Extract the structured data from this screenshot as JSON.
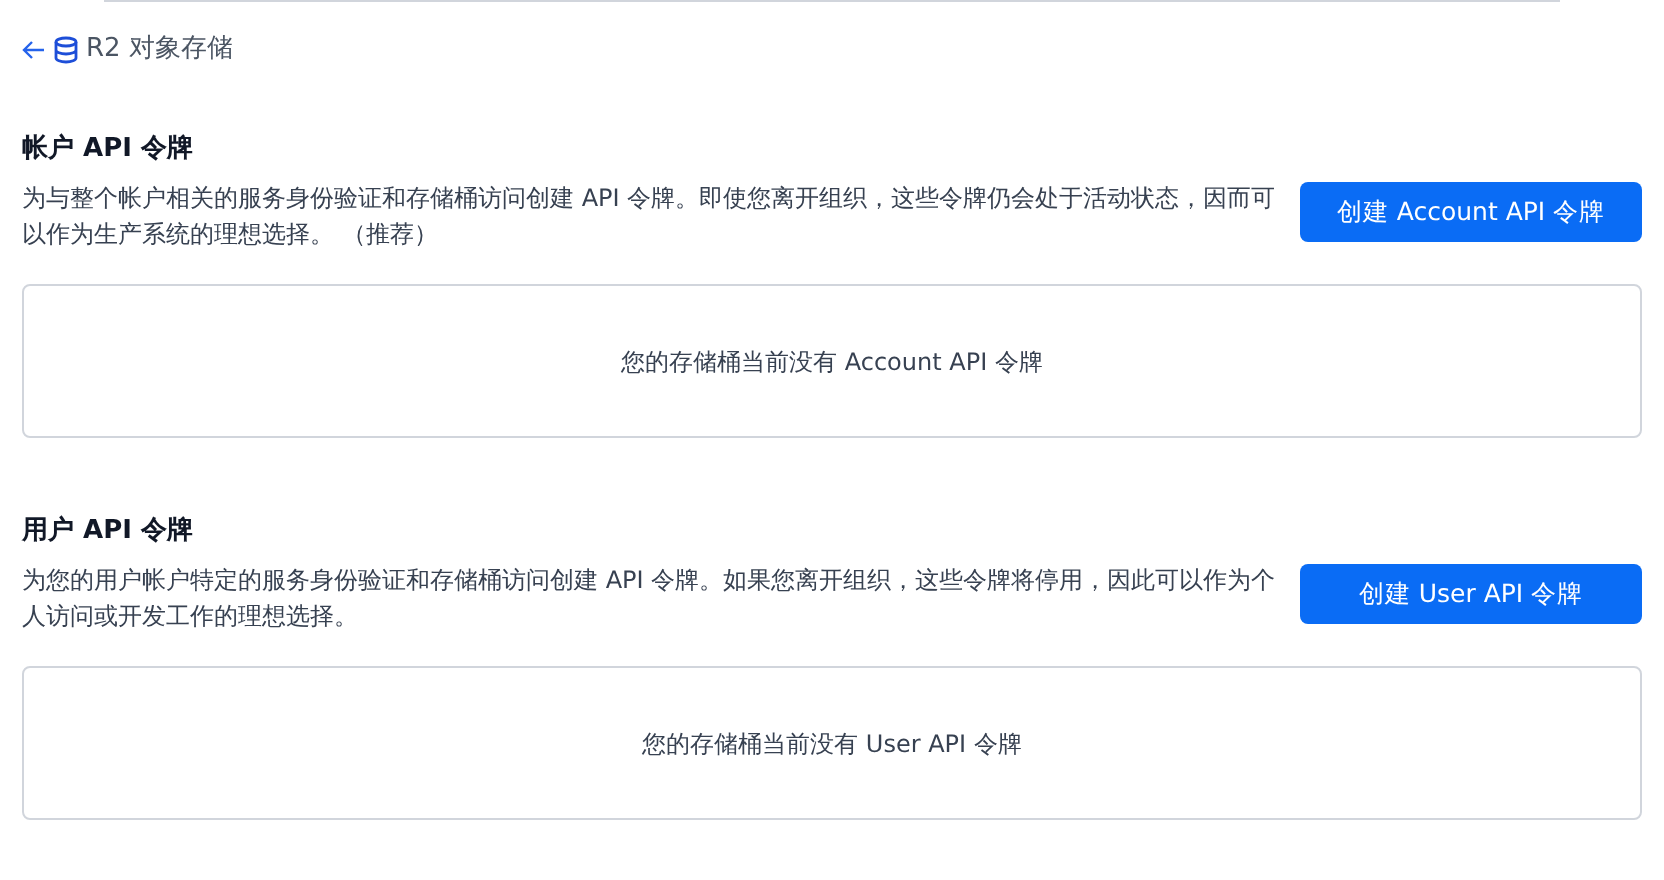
{
  "breadcrumb": {
    "label": "R2 对象存储"
  },
  "sections": [
    {
      "title": "帐户 API 令牌",
      "description": "为与整个帐户相关的服务身份验证和存储桶访问创建 API 令牌。即使您离开组织，这些令牌仍会处于活动状态，因而可以作为生产系统的理想选择。 （推荐）",
      "button": "创建 Account API 令牌",
      "empty_message": "您的存储桶当前没有 Account API 令牌"
    },
    {
      "title": "用户 API 令牌",
      "description": "为您的用户帐户特定的服务身份验证和存储桶访问创建 API 令牌。如果您离开组织，这些令牌将停用，因此可以作为个人访问或开发工作的理想选择。",
      "button": "创建 User API 令牌",
      "empty_message": "您的存储桶当前没有 User API 令牌"
    }
  ]
}
